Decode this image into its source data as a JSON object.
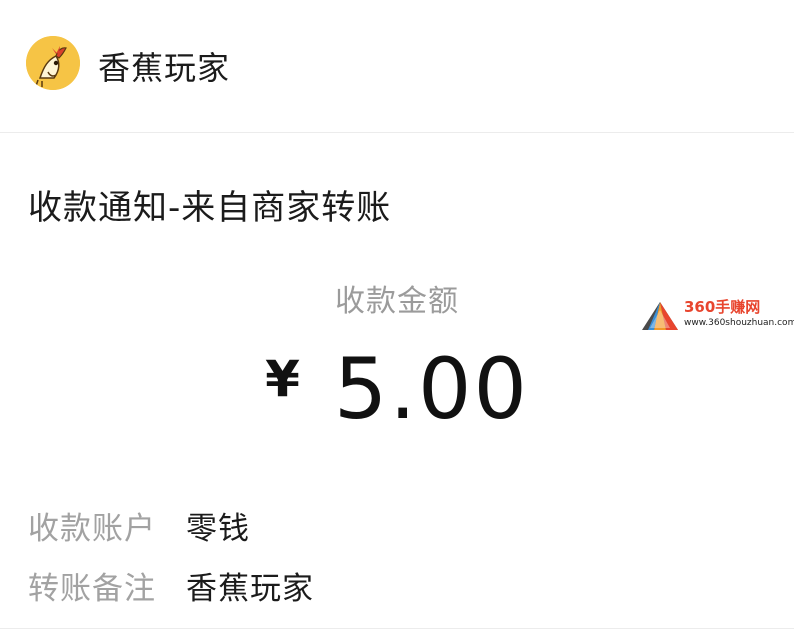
{
  "merchant": {
    "name": "香蕉玩家",
    "avatar_icon": "banana-mascot-icon"
  },
  "notice": {
    "title": "收款通知-来自商家转账"
  },
  "amount": {
    "label": "收款金额",
    "currency_symbol": "¥",
    "value": "5.00"
  },
  "details": [
    {
      "key": "收款账户",
      "value": "零钱"
    },
    {
      "key": "转账备注",
      "value": "香蕉玩家"
    }
  ],
  "watermark": {
    "title": "360手赚网",
    "url": "www.360shouzhuan.com",
    "logo_icon": "triangle-logo-icon"
  },
  "colors": {
    "primary_text": "#1b1b1b",
    "secondary_text": "#9b9b9b",
    "avatar_bg": "#f6c445",
    "watermark_red": "#e8452e"
  }
}
